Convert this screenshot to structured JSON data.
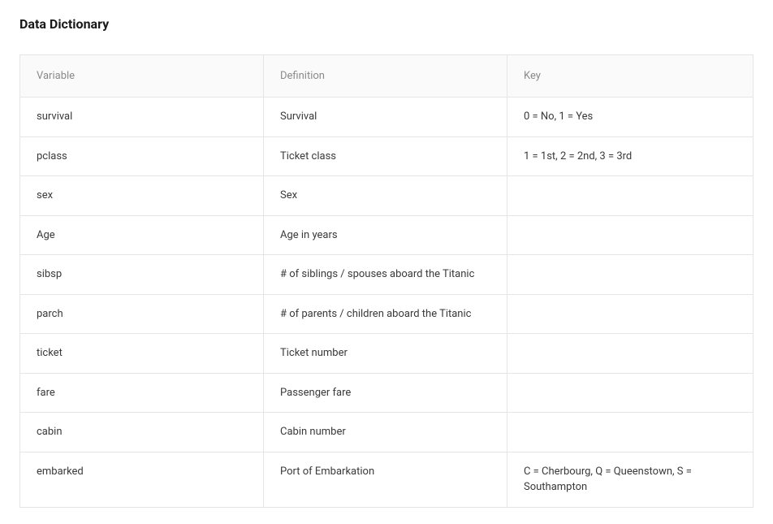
{
  "heading": "Data Dictionary",
  "table": {
    "headers": {
      "variable": "Variable",
      "definition": "Definition",
      "key": "Key"
    },
    "rows": [
      {
        "variable": "survival",
        "definition": "Survival",
        "key": "0 = No, 1 = Yes"
      },
      {
        "variable": "pclass",
        "definition": "Ticket class",
        "key": "1 = 1st, 2 = 2nd, 3 = 3rd"
      },
      {
        "variable": "sex",
        "definition": "Sex",
        "key": ""
      },
      {
        "variable": "Age",
        "definition": "Age in years",
        "key": ""
      },
      {
        "variable": "sibsp",
        "definition": "# of siblings / spouses aboard the Titanic",
        "key": ""
      },
      {
        "variable": "parch",
        "definition": "# of parents / children aboard the Titanic",
        "key": ""
      },
      {
        "variable": "ticket",
        "definition": "Ticket number",
        "key": ""
      },
      {
        "variable": "fare",
        "definition": "Passenger fare",
        "key": ""
      },
      {
        "variable": "cabin",
        "definition": "Cabin number",
        "key": ""
      },
      {
        "variable": "embarked",
        "definition": "Port of Embarkation",
        "key": "C = Cherbourg, Q = Queenstown, S = Southampton"
      }
    ]
  }
}
